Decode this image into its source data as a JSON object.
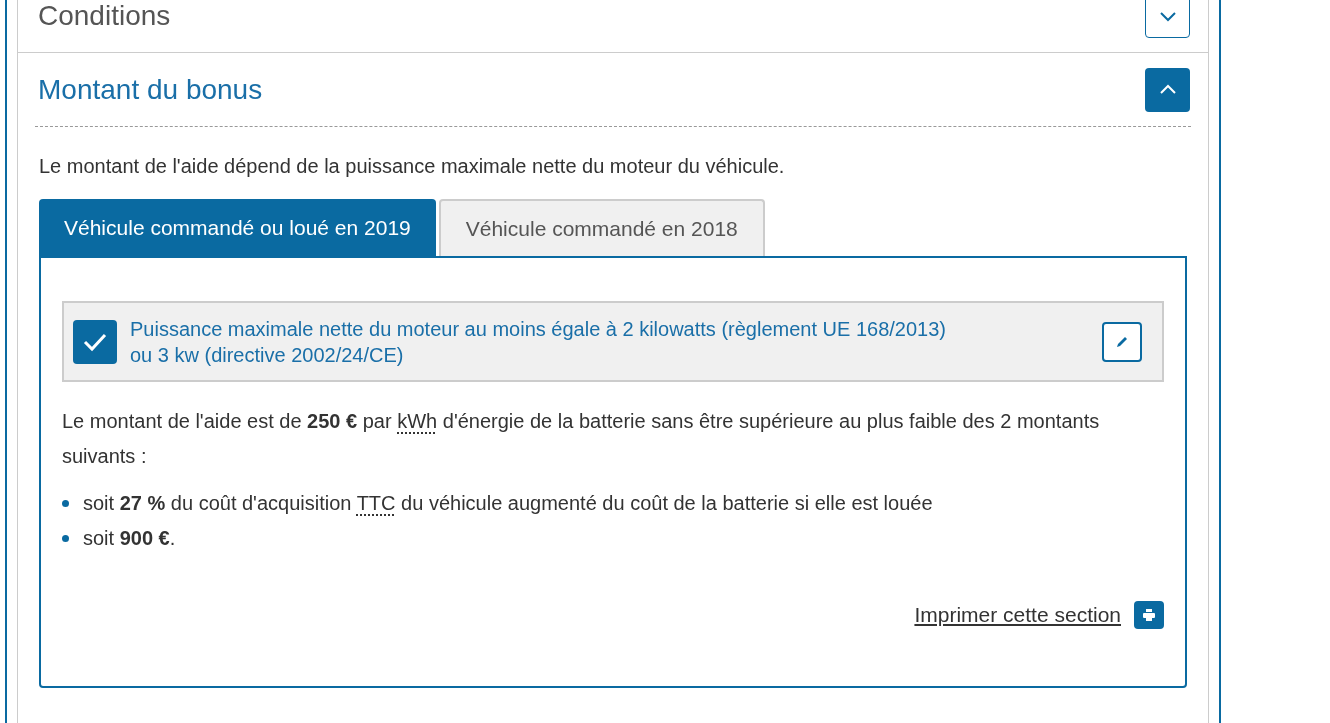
{
  "sections": [
    {
      "title": "Conditions",
      "expanded": false
    },
    {
      "title": "Montant du bonus",
      "expanded": true
    }
  ],
  "intro": "Le montant de l'aide dépend de la puissance maximale nette du moteur du véhicule.",
  "tabs": [
    {
      "label": "Véhicule commandé ou loué en 2019",
      "selected": true
    },
    {
      "label": "Véhicule commandé en 2018",
      "selected": false
    }
  ],
  "criterion": {
    "text": "Puissance maximale nette du moteur au moins égale à 2 kilowatts (règlement UE 168/2013) ou 3 kw (directive 2002/24/CE)",
    "checked": true
  },
  "paragraph": [
    {
      "kind": "text",
      "text": "Le montant de l'aide est de **250 €** par "
    },
    {
      "kind": "abbr",
      "text": "kWh"
    },
    {
      "kind": "text",
      "text": " d'énergie de la batterie sans être supérieure au plus faible des 2 montants suivants :"
    }
  ],
  "bullets": [
    [
      {
        "kind": "text",
        "text": "soit **27 %** du coût d'acquisition "
      },
      {
        "kind": "abbr",
        "text": "TTC"
      },
      {
        "kind": "text",
        "text": " du véhicule augmenté du coût de la batterie si elle est louée"
      }
    ],
    [
      {
        "kind": "text",
        "text": "soit **900 €**."
      }
    ]
  ],
  "print_link": "Imprimer cette section"
}
